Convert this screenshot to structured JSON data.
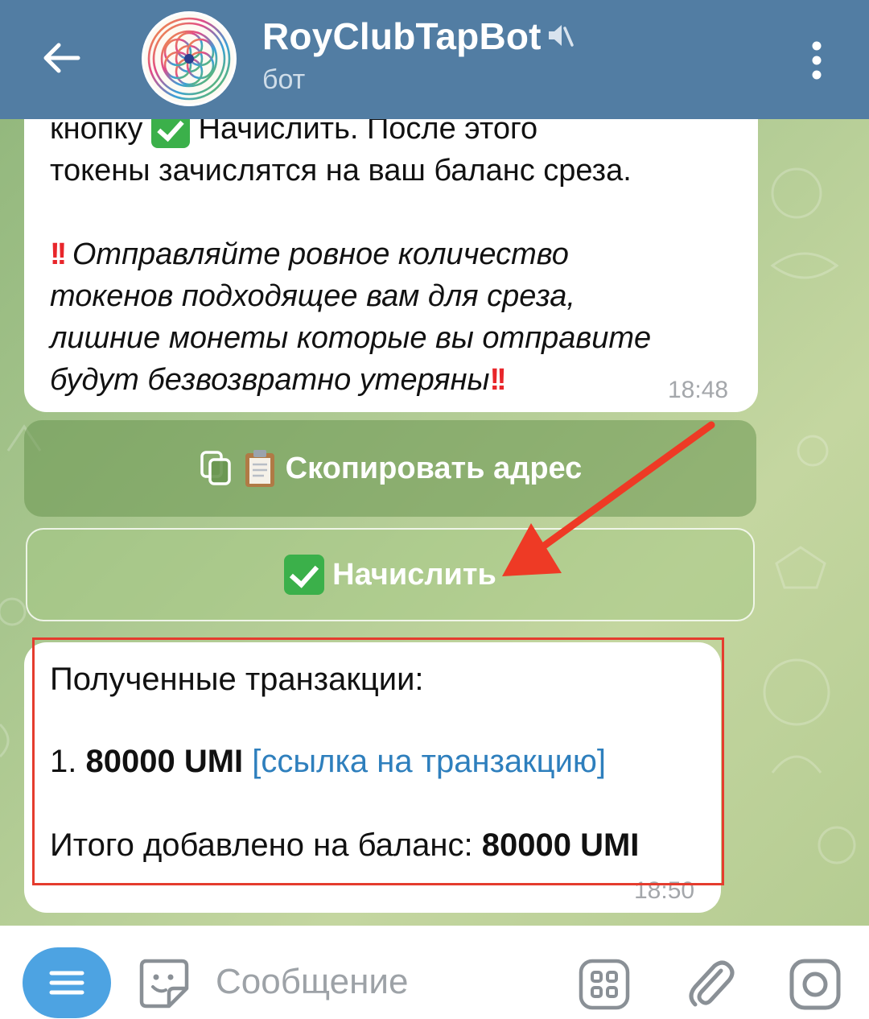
{
  "header": {
    "title": "RoyClubTapBot",
    "subtitle": "бот",
    "colors": {
      "bar": "#527da3",
      "text": "#ffffff"
    },
    "icons": {
      "back": "arrow-left-icon",
      "muted": "speaker-muted-icon",
      "menu": "more-vertical-icon"
    }
  },
  "messages": [
    {
      "lines": [
        "кнопку",
        "Начислить. После этого",
        "токены зачислятся на ваш баланс среза.",
        "Отправляйте ровное количество",
        "токенов подходящее вам для среза,",
        "лишние монеты которые вы отправите",
        "будут безвозвратно утеряны"
      ],
      "time": "18:48"
    },
    {
      "title": "Полученные транзакции:",
      "item_prefix": "1.",
      "item_amount": "80000 UMI",
      "item_link": "[ссылка на транзакцию]",
      "total_label": "Итого добавлено на баланс:",
      "total_amount": "80000 UMI",
      "time": "18:50"
    }
  ],
  "keyboard": {
    "copy_label": "Скопировать адрес",
    "charge_label": "Начислить"
  },
  "input": {
    "placeholder": "Сообщение",
    "accent": "#4da3e2"
  },
  "annotation": {
    "arrow_color": "#ee3a25",
    "frame_color": "#e53c2e"
  }
}
